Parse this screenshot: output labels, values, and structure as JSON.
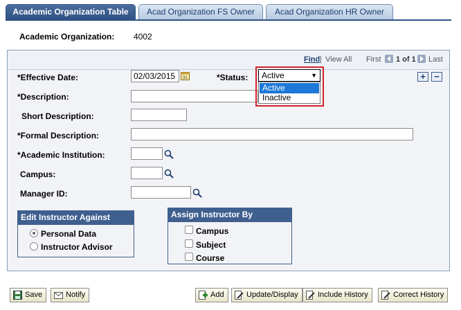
{
  "tabs": [
    {
      "label": "Academic Organization Table",
      "active": true
    },
    {
      "label": "Acad Organization FS Owner",
      "active": false
    },
    {
      "label": "Acad Organization HR Owner",
      "active": false
    }
  ],
  "header": {
    "org_label": "Academic Organization:",
    "org_value": "4002"
  },
  "nav": {
    "find": "Find",
    "view_all": "View All",
    "first": "First",
    "count": "1 of 1",
    "last": "Last"
  },
  "fields": {
    "effective_date_label": "*Effective Date:",
    "effective_date_value": "02/03/2015",
    "status_label": "*Status:",
    "description_label": "*Description:",
    "short_description_label": "Short Description:",
    "formal_description_label": "*Formal Description:",
    "academic_institution_label": "*Academic Institution:",
    "campus_label": "Campus:",
    "manager_id_label": "Manager ID:"
  },
  "status_dropdown": {
    "selected": "Active",
    "options": [
      "Active",
      "Inactive"
    ]
  },
  "edit_instructor": {
    "title": "Edit Instructor Against",
    "options": [
      {
        "label": "Personal Data",
        "checked": true
      },
      {
        "label": "Instructor Advisor",
        "checked": false
      }
    ]
  },
  "assign_instructor": {
    "title": "Assign Instructor By",
    "options": [
      {
        "label": "Campus",
        "checked": false
      },
      {
        "label": "Subject",
        "checked": false
      },
      {
        "label": "Course",
        "checked": false
      }
    ]
  },
  "buttons": {
    "save": "Save",
    "notify": "Notify",
    "add": "Add",
    "update_display": "Update/Display",
    "include_history": "Include History",
    "correct_history": "Correct History"
  },
  "colors": {
    "accent": "#3f5f8f",
    "highlight_border": "#d0222a",
    "selected_option": "#1e78d7"
  }
}
